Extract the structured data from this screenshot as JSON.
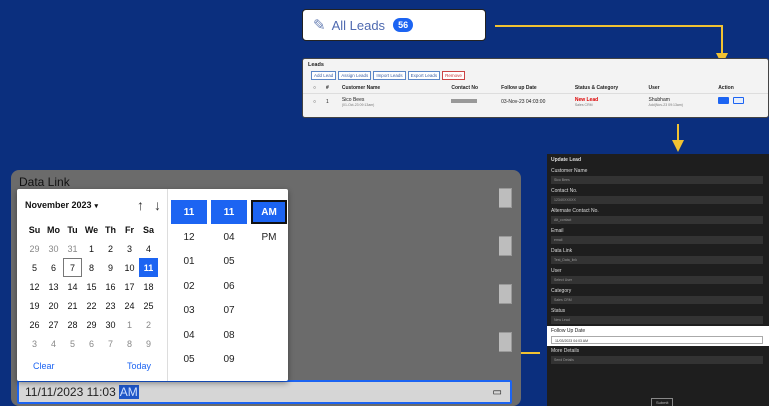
{
  "all_leads": {
    "label": "All Leads",
    "count": "56"
  },
  "leads_table": {
    "title": "Leads",
    "buttons": [
      "Add Lead",
      "Assign Leads",
      "Import Leads",
      "Export Leads",
      "Remove"
    ],
    "columns": [
      "#",
      "Customer Name",
      "Contact No",
      "Follow up Date",
      "Status & Category",
      "User",
      "Action"
    ],
    "row": {
      "num": "1",
      "customer": "Sico Bees",
      "customer_sub": "(01-Oct-23 09:13am)",
      "follow_up": "03-Nov-23 04:03:00",
      "status": "New Lead",
      "category": "Sales CRM",
      "user": "Shubham",
      "user_sub": "Add(Nov-23 09:13am)"
    }
  },
  "update_lead": {
    "title": "Update Lead",
    "fields": [
      {
        "label": "Customer Name",
        "value": "Sico Bees"
      },
      {
        "label": "Contact No.",
        "value": "1234XXXXXX"
      },
      {
        "label": "Alternate Contact No.",
        "value": "Alt_contact"
      },
      {
        "label": "Email",
        "value": "email"
      },
      {
        "label": "Data Link",
        "value": "Test_Data_link"
      },
      {
        "label": "User",
        "value": "Select User"
      },
      {
        "label": "Category",
        "value": "Sales CRM"
      },
      {
        "label": "Status",
        "value": "New Lead"
      },
      {
        "label": "Follow Up Date",
        "value": "11/03/2023 04:03 AM"
      },
      {
        "label": "More Details",
        "value": "Send Details"
      }
    ],
    "submit_label": "Submit"
  },
  "form": {
    "title": "Data Link",
    "date_value": "11/11/2023 11:03",
    "date_ampm": "AM"
  },
  "calendar": {
    "month_label": "November 2023",
    "weekdays": [
      "Su",
      "Mo",
      "Tu",
      "We",
      "Th",
      "Fr",
      "Sa"
    ],
    "days": [
      [
        "29",
        "30",
        "31",
        "1",
        "2",
        "3",
        "4"
      ],
      [
        "5",
        "6",
        "7",
        "8",
        "9",
        "10",
        "11"
      ],
      [
        "12",
        "13",
        "14",
        "15",
        "16",
        "17",
        "18"
      ],
      [
        "19",
        "20",
        "21",
        "22",
        "23",
        "24",
        "25"
      ],
      [
        "26",
        "27",
        "28",
        "29",
        "30",
        "1",
        "2"
      ],
      [
        "3",
        "4",
        "5",
        "6",
        "7",
        "8",
        "9"
      ]
    ],
    "clear_label": "Clear",
    "today_label": "Today",
    "hours": [
      "11",
      "12",
      "01",
      "02",
      "03",
      "04",
      "05"
    ],
    "minutes": [
      "11",
      "04",
      "05",
      "06",
      "07",
      "08",
      "09"
    ],
    "periods": [
      "AM",
      "PM"
    ]
  },
  "colors": {
    "accent": "#1c64f2",
    "background": "#0b2f7e",
    "connector": "#f1c232"
  }
}
